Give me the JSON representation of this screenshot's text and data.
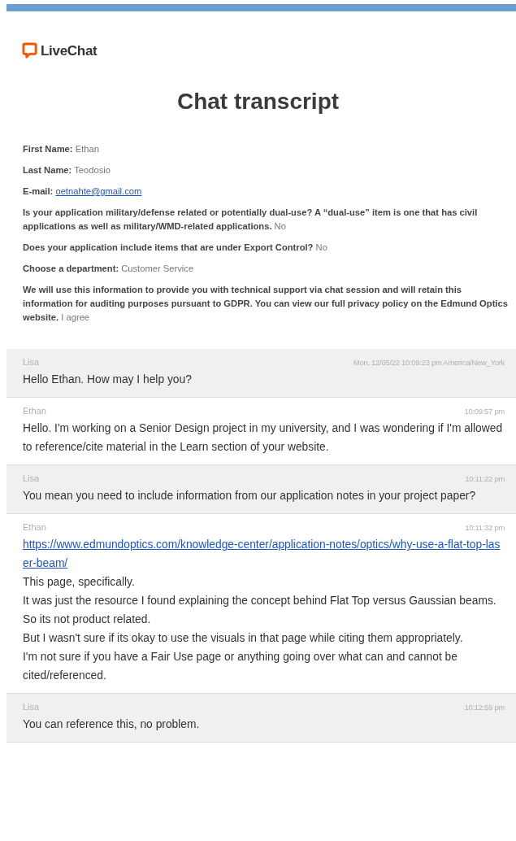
{
  "brand": {
    "name": "LiveChat"
  },
  "title": "Chat transcript",
  "fields": [
    {
      "label": "First Name:",
      "value": "Ethan",
      "kind": "text"
    },
    {
      "label": "Last Name:",
      "value": "Teodosio",
      "kind": "text"
    },
    {
      "label": "E-mail:",
      "value": "oetnahte@gmail.com",
      "kind": "link"
    },
    {
      "label": "Is your application military/defense related or potentially dual-use? A “dual-use” item is one that has civil applications as well as military/WMD-related applications.",
      "value": "No",
      "kind": "text"
    },
    {
      "label": "Does your application include items that are under Export Control?",
      "value": "No",
      "kind": "text"
    },
    {
      "label": "Choose a department:",
      "value": "Customer Service",
      "kind": "text"
    },
    {
      "label": "We will use this information to provide you with technical support via chat session and will retain this information for auditing purposes pursuant to GDPR. You can view our full privacy policy on the Edmund Optics website.",
      "value": "I agree",
      "kind": "text"
    }
  ],
  "messages": [
    {
      "author": "Lisa",
      "shaded": true,
      "time": "Mon, 12/05/22 10:09:23 pm America/New_York",
      "lines": [
        {
          "kind": "text",
          "text": "Hello Ethan. How may I help you?"
        }
      ]
    },
    {
      "author": "Ethan",
      "shaded": false,
      "time": "10:09:57 pm",
      "lines": [
        {
          "kind": "text",
          "text": "Hello. I'm working on a Senior Design project in my university, and I was wondering if I'm allowed to reference/cite material in the Learn section of your website."
        }
      ]
    },
    {
      "author": "Lisa",
      "shaded": true,
      "time": "10:11:22 pm",
      "lines": [
        {
          "kind": "text",
          "text": "You mean you need to include information from our application notes in your project paper?"
        }
      ]
    },
    {
      "author": "Ethan",
      "shaded": false,
      "time": "10:11:32 pm",
      "lines": [
        {
          "kind": "link",
          "text": "https://www.edmundoptics.com/knowledge-center/application-notes/optics/why-use-a-flat-top-laser-beam/"
        },
        {
          "kind": "text",
          "text": "This page, specifically."
        },
        {
          "kind": "text",
          "text": "It was just the resource I found explaining the concept behind Flat Top versus Gaussian beams."
        },
        {
          "kind": "text",
          "text": "So its not product related."
        },
        {
          "kind": "text",
          "text": "But I wasn't sure if its okay to use the visuals in that page while citing them appropriately."
        },
        {
          "kind": "text",
          "text": "I'm not sure if you have a Fair Use page or anything going over what can and cannot be cited/referenced."
        }
      ]
    },
    {
      "author": "Lisa",
      "shaded": true,
      "time": "10:12:59 pm",
      "lines": [
        {
          "kind": "text",
          "text": "You can reference this, no problem."
        }
      ]
    }
  ]
}
